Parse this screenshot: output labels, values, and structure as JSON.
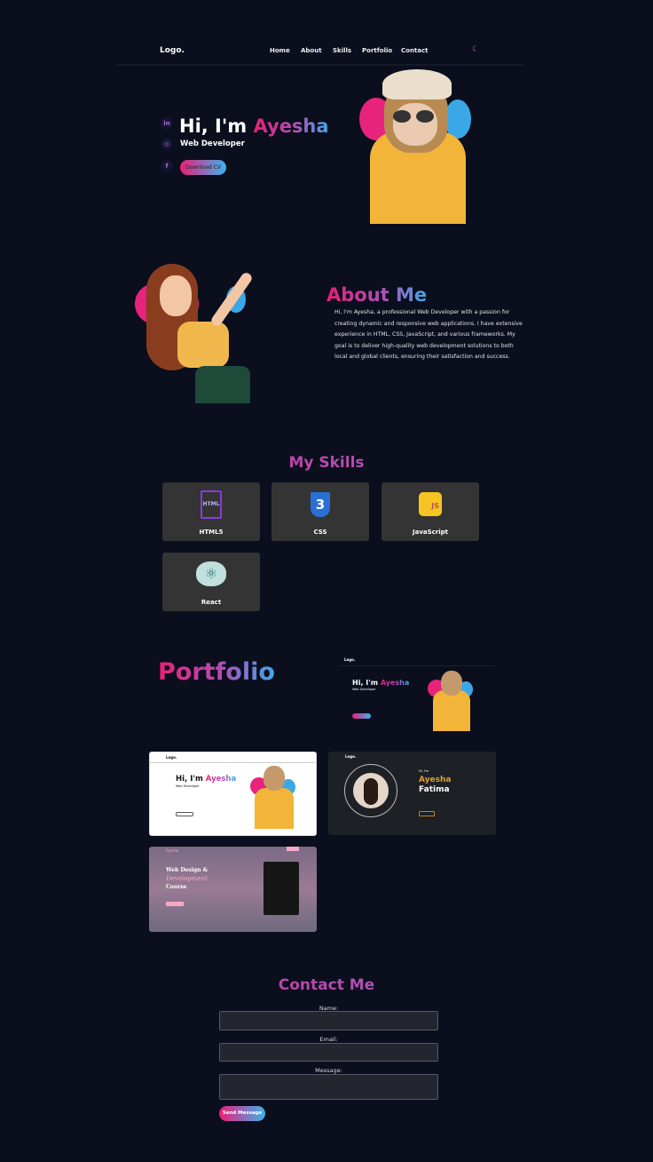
{
  "header": {
    "logo": "Logo.",
    "nav": [
      "Home",
      "About",
      "Skills",
      "Portfolio",
      "Contact"
    ],
    "theme_icon": "moon-icon"
  },
  "hero": {
    "greeting": "Hi, I'm ",
    "name": "Ayesha",
    "role": "Web Developer",
    "cta": "Download CV",
    "socials": [
      "linkedin-icon",
      "instagram-icon",
      "facebook-icon"
    ]
  },
  "about": {
    "title": "About Me",
    "text": "Hi, I'm Ayesha, a professional Web Developer with a passion for creating dynamic and responsive web applications. I have extensive experience in HTML, CSS, JavaScript, and various frameworks. My goal is to deliver high-quality web development solutions to both local and global clients, ensuring their satisfaction and success."
  },
  "skills": {
    "title": "My Skills",
    "items": [
      {
        "label": "HTML5",
        "icon": "html5-icon"
      },
      {
        "label": "CSS",
        "icon": "css3-icon"
      },
      {
        "label": "JavaScript",
        "icon": "javascript-icon"
      },
      {
        "label": "React",
        "icon": "react-icon"
      }
    ]
  },
  "portfolio": {
    "title": "Portfolio",
    "projects": [
      {
        "logo": "Logo.",
        "greeting": "Hi, I'm ",
        "name": "Ayesha",
        "role": "Web Developer"
      },
      {
        "logo": "Logo.",
        "greeting": "Hi, I'm ",
        "name": "Ayesha",
        "role": "Web Developer"
      },
      {
        "logo": "Logo.",
        "intro": "Hi, I'm",
        "name": "Ayesha",
        "surname": "Fatima"
      },
      {
        "logo": "Ayesha",
        "title1": "Web Design &",
        "title2": "Development",
        "title3": "Course"
      }
    ]
  },
  "contact": {
    "title": "Contact Me",
    "name_label": "Name:",
    "email_label": "Email:",
    "message_label": "Message:",
    "send": "Send Message"
  },
  "colors": {
    "background": "#0a0e1d",
    "pink": "#e91e77",
    "blue": "#3fa9e8",
    "card": "#343434"
  }
}
